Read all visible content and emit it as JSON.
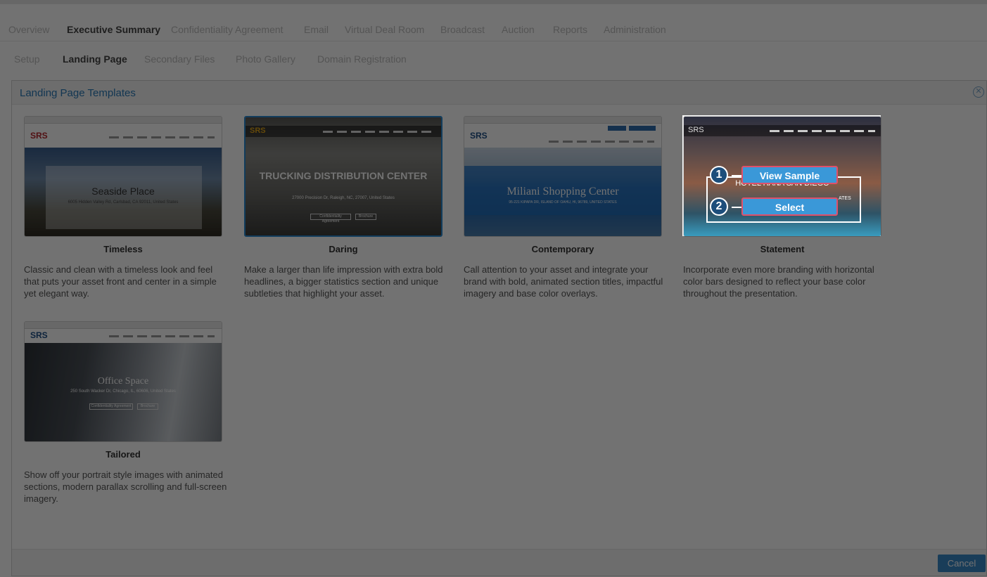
{
  "top_nav": {
    "items": [
      "Overview",
      "Executive Summary",
      "Confidentiality Agreement",
      "Email",
      "Virtual Deal Room",
      "Broadcast",
      "Auction",
      "Reports",
      "Administration"
    ],
    "active": "Executive Summary"
  },
  "sub_nav": {
    "items": [
      "Setup",
      "Landing Page",
      "Secondary Files",
      "Photo Gallery",
      "Domain Registration"
    ],
    "active": "Landing Page"
  },
  "modal": {
    "title": "Landing Page Templates",
    "close_icon": "close-circle-icon",
    "cancel_label": "Cancel"
  },
  "templates": [
    {
      "name": "Timeless",
      "description": "Classic and clean with a timeless look and feel that puts your asset front and center in a simple yet elegant way.",
      "hero_title": "Seaside Place",
      "hero_sub": "6005 Hidden Valley Rd, Carlsbad, CA 92011, United States",
      "logo": "SRS"
    },
    {
      "name": "Daring",
      "description": "Make a larger than life impression with extra bold headlines, a bigger statistics section and unique subtleties that highlight your asset.",
      "hero_title": "TRUCKING DISTRIBUTION CENTER",
      "hero_sub": "27000 Precision Dr, Raleigh, NC, 27007, United States",
      "logo": "SRS",
      "pill1": "Confidentiality Agreement",
      "pill2": "Brochure",
      "selected": true
    },
    {
      "name": "Contemporary",
      "description": "Call attention to your asset and integrate your brand with bold, animated section titles, impactful imagery and base color overlays.",
      "hero_title": "Miliani Shopping Center",
      "hero_sub": "95-221 KIPAPA DR, ISLAND OF OAHU, HI, 96789, UNITED STATES",
      "logo": "SRS"
    },
    {
      "name": "Statement",
      "description": "Incorporate even more branding with horizontal color bars designed to reflect your base color throughout the presentation.",
      "hero_title": "HOTEL HANA SAN DIEGO",
      "hero_sub": "ATES",
      "logo": "SRS",
      "view_sample_label": "View Sample",
      "select_label": "Select",
      "step1": "1",
      "step2": "2"
    },
    {
      "name": "Tailored",
      "description": "Show off your portrait style images with animated sections, modern parallax scrolling and full-screen imagery.",
      "hero_title": "Office Space",
      "hero_sub": "250 South Wacker Dr, Chicago, IL, 60606, United States",
      "logo": "SRS",
      "pill1": "Confidentiality Agreement",
      "pill2": "Brochure"
    }
  ],
  "colors": {
    "accent": "#2a7ab8",
    "button": "#3a98d8",
    "highlight": "#e0506a",
    "logo_red": "#b7282e"
  }
}
